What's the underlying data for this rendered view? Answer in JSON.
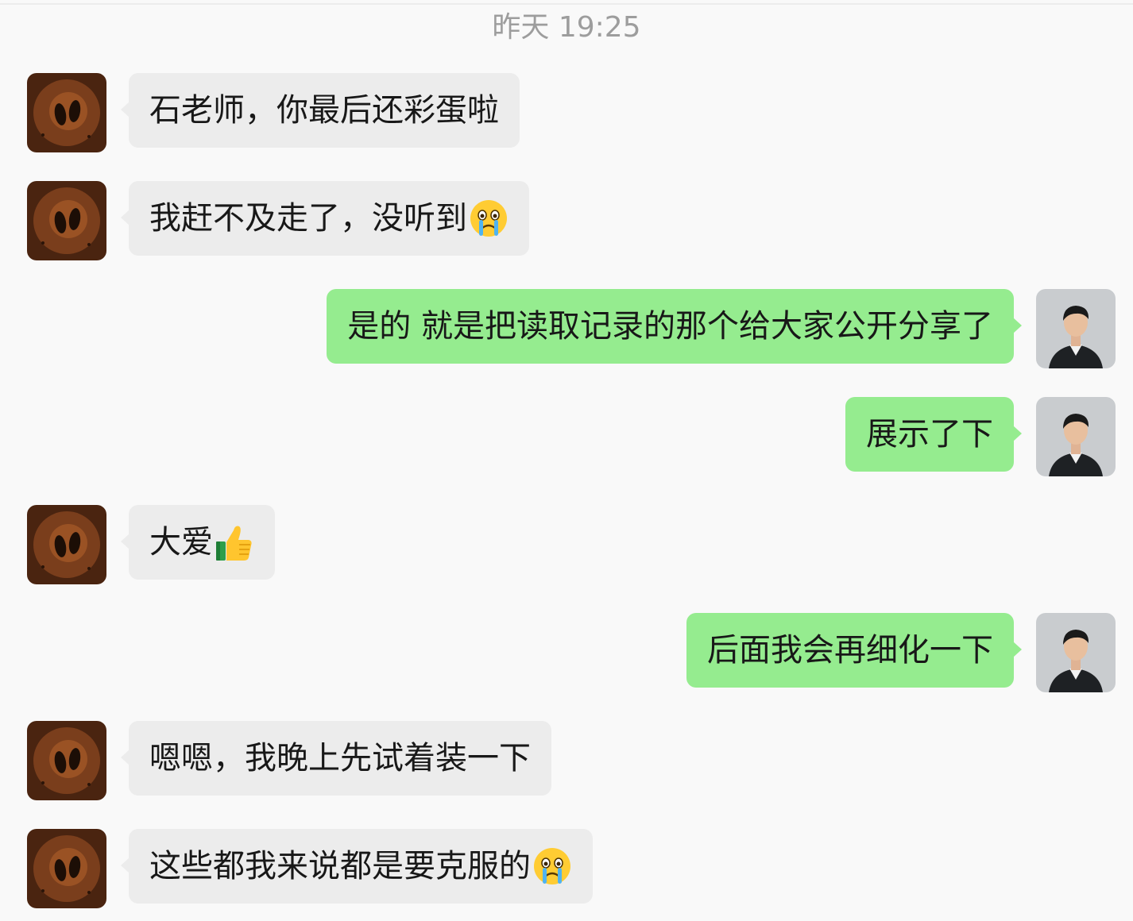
{
  "chat": {
    "timestamp": "昨天 19:25",
    "colors": {
      "background": "#f9f9f9",
      "incoming_bubble": "#ececec",
      "outgoing_bubble": "#95ec8f"
    },
    "messages": [
      {
        "side": "left",
        "sender": "other",
        "text": "石老师，你最后还彩蛋啦",
        "emoji": ""
      },
      {
        "side": "left",
        "sender": "other",
        "text": "我赶不及走了，没听到",
        "emoji": "crying-face"
      },
      {
        "side": "right",
        "sender": "me",
        "text": "是的 就是把读取记录的那个给大家公开分享了",
        "emoji": ""
      },
      {
        "side": "right",
        "sender": "me",
        "text": "展示了下",
        "emoji": ""
      },
      {
        "side": "left",
        "sender": "other",
        "text": "大爱",
        "emoji": "thumbs-up"
      },
      {
        "side": "right",
        "sender": "me",
        "text": "后面我会再细化一下",
        "emoji": ""
      },
      {
        "side": "left",
        "sender": "other",
        "text": "嗯嗯，我晚上先试着装一下",
        "emoji": ""
      },
      {
        "side": "left",
        "sender": "other",
        "text": "这些都我来说都是要克服的",
        "emoji": "crying-face"
      }
    ]
  }
}
